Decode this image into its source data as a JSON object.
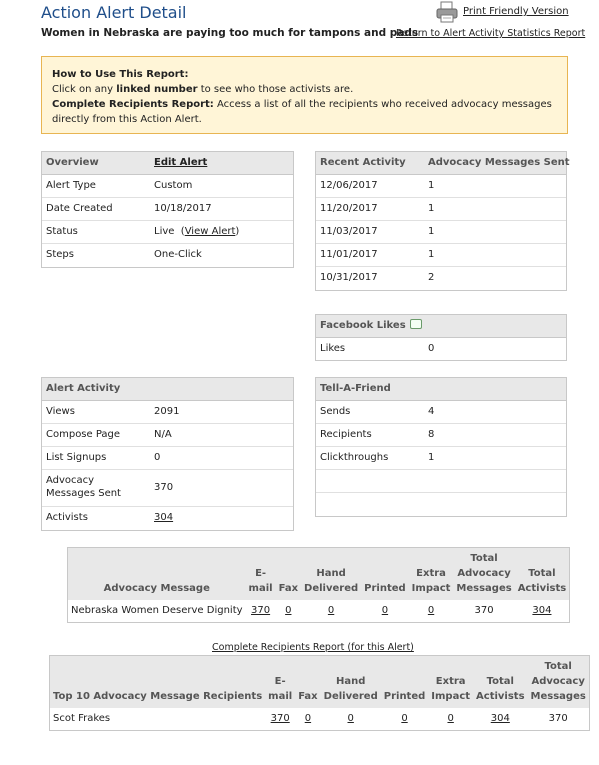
{
  "header": {
    "title": "Action Alert Detail",
    "print_label": "Print Friendly Version",
    "subtitle": "Women in Nebraska are paying too much for tampons and pads",
    "return_label": "Return to Alert Activity Statistics Report"
  },
  "howto": {
    "heading": "How to Use This Report:",
    "line1_pre": "Click on any ",
    "line1_bold": "linked number",
    "line1_post": " to see who those activists are.",
    "line2_bold": "Complete Recipients Report:",
    "line2_post": " Access a list of all the recipients who received advocacy messages directly from this Action Alert."
  },
  "overview": {
    "header_label": "Overview",
    "edit_label": "Edit Alert",
    "rows": [
      {
        "label": "Alert Type",
        "value": "Custom"
      },
      {
        "label": "Date Created",
        "value": "10/18/2017"
      },
      {
        "label": "Status",
        "value": "Live",
        "link_pre": "(",
        "link": "View Alert",
        "link_post": ")"
      },
      {
        "label": "Steps",
        "value": "One-Click"
      }
    ]
  },
  "recent": {
    "col1": "Recent Activity",
    "col2": "Advocacy Messages Sent",
    "rows": [
      {
        "date": "12/06/2017",
        "count": "1"
      },
      {
        "date": "11/20/2017",
        "count": "1"
      },
      {
        "date": "11/03/2017",
        "count": "1"
      },
      {
        "date": "11/01/2017",
        "count": "1"
      },
      {
        "date": "10/31/2017",
        "count": "2"
      }
    ]
  },
  "facebook": {
    "header_label": "Facebook Likes",
    "likes_label": "Likes",
    "likes_value": "0"
  },
  "activity": {
    "header_label": "Alert Activity",
    "rows": [
      {
        "label": "Views",
        "value": "2091"
      },
      {
        "label": "Compose Page",
        "value": "N/A"
      },
      {
        "label": "List Signups",
        "value": "0"
      },
      {
        "label": "Advocacy Messages Sent",
        "value": "370"
      },
      {
        "label": "Activists",
        "value": "304"
      }
    ]
  },
  "taf": {
    "header_label": "Tell-A-Friend",
    "rows": [
      {
        "label": "Sends",
        "value": "4"
      },
      {
        "label": "Recipients",
        "value": "8"
      },
      {
        "label": "Clickthroughs",
        "value": "1"
      }
    ]
  },
  "messages_table": {
    "headers": [
      "Advocacy Message",
      "E-mail",
      "Fax",
      "Hand Delivered",
      "Printed",
      "Extra Impact",
      "Total Advocacy Messages",
      "Total Activists"
    ],
    "rows": [
      {
        "message": "Nebraska Women Deserve Dignity",
        "email": "370",
        "fax": "0",
        "hand": "0",
        "printed": "0",
        "extra": "0",
        "total_msgs": "370",
        "total_activists": "304"
      }
    ]
  },
  "complete_link": "Complete Recipients Report (for this Alert)",
  "recipients_table": {
    "headers": [
      "Top 10 Advocacy Message Recipients",
      "E-mail",
      "Fax",
      "Hand Delivered",
      "Printed",
      "Extra Impact",
      "Total Activists",
      "Total Advocacy Messages"
    ],
    "rows": [
      {
        "name": "Scot Frakes",
        "email": "370",
        "fax": "0",
        "hand": "0",
        "printed": "0",
        "extra": "0",
        "total_activists": "304",
        "total_msgs": "370"
      }
    ]
  }
}
